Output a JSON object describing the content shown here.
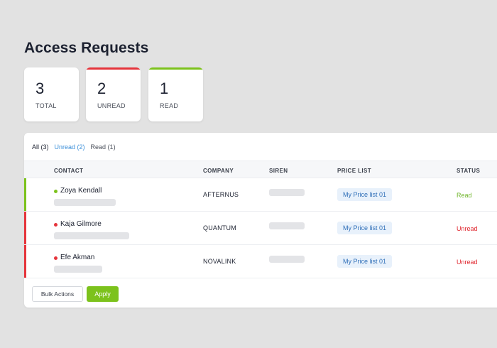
{
  "page": {
    "title": "Access Requests"
  },
  "stats": [
    {
      "value": "3",
      "label": "TOTAL",
      "accent": ""
    },
    {
      "value": "2",
      "label": "UNREAD",
      "accent": "#e5343b"
    },
    {
      "value": "1",
      "label": "READ",
      "accent": "#7cc21c"
    }
  ],
  "filters": {
    "all": "All (3)",
    "unread": "Unread (2)",
    "read": "Read (1)"
  },
  "table": {
    "headers": {
      "contact": "CONTACT",
      "company": "COMPANY",
      "siren": "SIREN",
      "price_list": "PRICE LIST",
      "status": "STATUS"
    },
    "rows": [
      {
        "name": "Zoya Kendall",
        "company": "AFTERNUS",
        "price_list": "My Price list 01",
        "status": "Read",
        "status_color": "#6fb52a",
        "indicator": "#7cc21c"
      },
      {
        "name": "Kaja Gilmore",
        "company": "QUANTUM",
        "price_list": "My Price list 01",
        "status": "Unread",
        "status_color": "#e0262e",
        "indicator": "#e5343b"
      },
      {
        "name": "Efe Akman",
        "company": "NOVALINK",
        "price_list": "My Price list 01",
        "status": "Unread",
        "status_color": "#e0262e",
        "indicator": "#e5343b"
      }
    ]
  },
  "actions": {
    "bulk_label": "Bulk Actions",
    "apply_label": "Apply"
  }
}
